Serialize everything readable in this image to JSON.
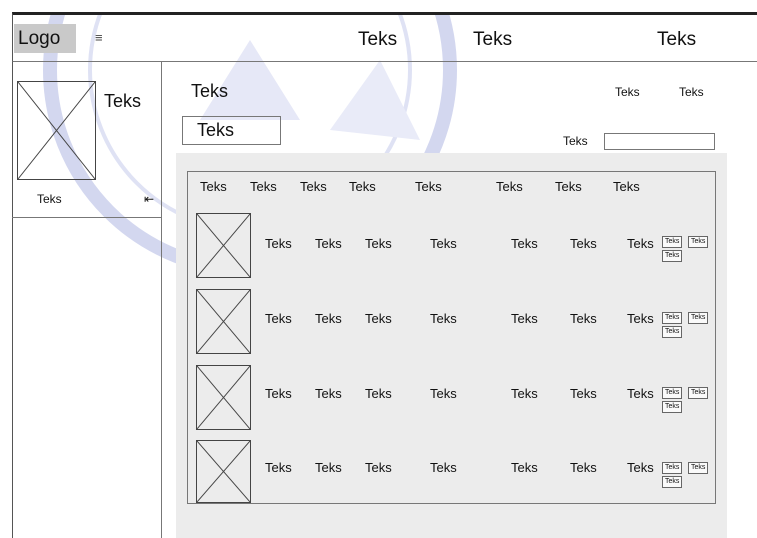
{
  "header": {
    "logo": "Logo",
    "menu_icon": "hamburger-icon",
    "nav": [
      "Teks",
      "Teks",
      "Teks"
    ]
  },
  "sidebar": {
    "title": "Teks",
    "item_label": "Teks",
    "collapse_icon": "collapse-left-icon"
  },
  "main": {
    "title": "Teks",
    "subtitle_box": "Teks",
    "top_links": [
      "Teks",
      "Teks"
    ],
    "search_label": "Teks",
    "search_value": ""
  },
  "table": {
    "columns": [
      "Teks",
      "Teks",
      "Teks",
      "Teks",
      "Teks",
      "Teks",
      "Teks",
      "Teks"
    ],
    "rows": [
      {
        "cells": [
          "Teks",
          "Teks",
          "Teks",
          "Teks",
          "Teks",
          "Teks",
          "Teks"
        ],
        "actions": [
          "Teks",
          "Teks",
          "Teks"
        ]
      },
      {
        "cells": [
          "Teks",
          "Teks",
          "Teks",
          "Teks",
          "Teks",
          "Teks",
          "Teks"
        ],
        "actions": [
          "Teks",
          "Teks",
          "Teks"
        ]
      },
      {
        "cells": [
          "Teks",
          "Teks",
          "Teks",
          "Teks",
          "Teks",
          "Teks",
          "Teks"
        ],
        "actions": [
          "Teks",
          "Teks",
          "Teks"
        ]
      },
      {
        "cells": [
          "Teks",
          "Teks",
          "Teks",
          "Teks",
          "Teks",
          "Teks",
          "Teks"
        ],
        "actions": [
          "Teks",
          "Teks",
          "Teks"
        ]
      }
    ]
  },
  "colors": {
    "panel_bg": "#ececec",
    "logo_bg": "#c9c9c9",
    "watermark": "#c8cdea"
  }
}
